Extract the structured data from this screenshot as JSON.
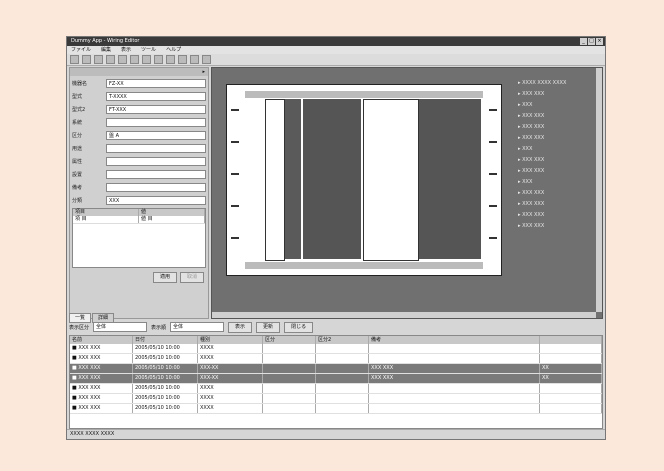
{
  "window": {
    "title": "Dummy App - Wiring Editor"
  },
  "menu": [
    "ファイル",
    "編集",
    "表示",
    "ツール",
    "ヘルプ"
  ],
  "left_panel": {
    "header": "▸",
    "fields": [
      {
        "label": "機器名",
        "value": "FZ-XX"
      },
      {
        "label": "型式",
        "value": "T-XXXX"
      },
      {
        "label": "型式2",
        "value": "FT-XXX"
      },
      {
        "label": "系統",
        "value": ""
      },
      {
        "label": "区分",
        "value": "盤 A"
      },
      {
        "label": "用途",
        "value": ""
      },
      {
        "label": "属性",
        "value": ""
      },
      {
        "label": "設置",
        "value": ""
      },
      {
        "label": "備考",
        "value": ""
      },
      {
        "label": "分類",
        "value": "XXX"
      }
    ],
    "grid": {
      "headers": [
        "項目",
        "値"
      ],
      "rows": [
        [
          "項 目",
          "値 目"
        ]
      ]
    },
    "buttons": {
      "apply": "適用",
      "cancel": "取消"
    }
  },
  "tabs": [
    "一覧",
    "詳細"
  ],
  "tree": [
    "▸ XXXX XXXX XXXX",
    "▸ XXX XXX",
    "  ▸ XXX",
    "  ▸ XXX XXX",
    "  ▸ XXX XXX",
    "  ▸ XXX XXX",
    "  ▸ XXX",
    "  ▸ XXX XXX",
    "  ▸ XXX XXX",
    "  ▸ XXX",
    "  ▸ XXX XXX",
    "  ▸ XXX XXX",
    "  ▸ XXX XXX",
    "  ▸ XXX XXX"
  ],
  "filter": {
    "label1": "表示区分",
    "select1": "全体",
    "label2": "表示順",
    "select2": "全体",
    "btn1": "表示",
    "btn2": "更新",
    "btn3": "閉じる"
  },
  "list": {
    "headers": [
      "名前",
      "日付",
      "種別",
      "区分",
      "区分2",
      "備考",
      ""
    ],
    "rows": [
      {
        "c": [
          "■ XXX XXX",
          "2005/05/10 10:00",
          "XXXX",
          "",
          "",
          "",
          ""
        ],
        "selected": false
      },
      {
        "c": [
          "■ XXX XXX",
          "2005/05/10 10:00",
          "XXXX",
          "",
          "",
          "",
          ""
        ],
        "selected": false
      },
      {
        "c": [
          "■ XXX XXX",
          "2005/05/10 10:00",
          "XXX-XX",
          "",
          "",
          "XXX XXX",
          "XX"
        ],
        "selected": true
      },
      {
        "c": [
          "■ XXX XXX",
          "2005/05/10 10:00",
          "XXX-XX",
          "",
          "",
          "XXX XXX",
          "XX"
        ],
        "selected": true
      },
      {
        "c": [
          "■ XXX XXX",
          "2005/05/10 10:00",
          "XXXX",
          "",
          "",
          "",
          ""
        ],
        "selected": false
      },
      {
        "c": [
          "■ XXX XXX",
          "2005/05/10 10:00",
          "XXXX",
          "",
          "",
          "",
          ""
        ],
        "selected": false
      },
      {
        "c": [
          "■ XXX XXX",
          "2005/05/10 10:00",
          "XXXX",
          "",
          "",
          "",
          ""
        ],
        "selected": false
      }
    ]
  },
  "status": {
    "text": "XXXX XXXX XXXX"
  }
}
